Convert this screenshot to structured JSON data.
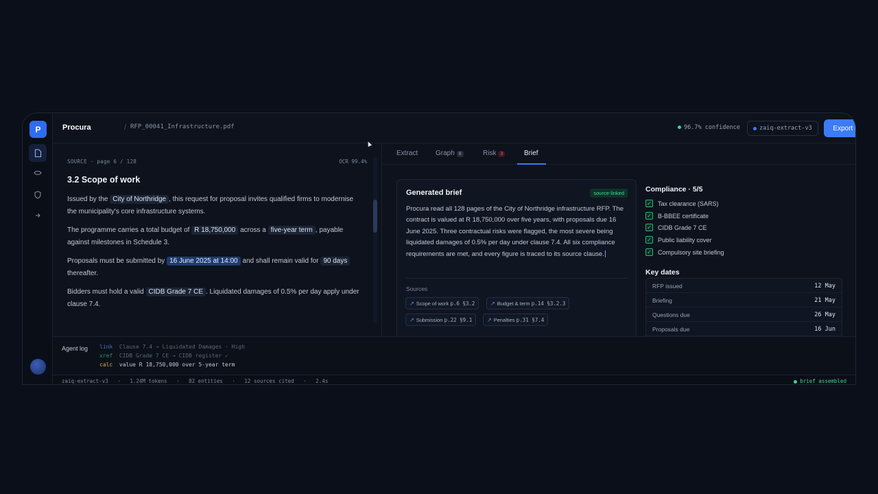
{
  "app": {
    "brand": "Procura",
    "separator": "/",
    "filename": "RFP_00041_Infrastructure.pdf",
    "logo_letter": "P"
  },
  "header": {
    "confidence": "96.7% confidence",
    "model": "zaiq-extract-v3",
    "export_label": "Export brief",
    "accent": "#3b7cf6"
  },
  "rail": {
    "icons": [
      "document-icon",
      "eye-icon",
      "shield-icon",
      "arrow-icon"
    ]
  },
  "source": {
    "meta": "SOURCE · page 6 / 128",
    "ocr": "OCR 99.4%",
    "heading": "3.2 Scope of work",
    "p1": {
      "a": "Issued by the",
      "city": "City of Northridge",
      "b": ", this request for proposal invites qualified firms to modernise the municipality's core infrastructure systems."
    },
    "p2": {
      "a": "The programme carries a total budget of",
      "budget": "R 18,750,000",
      "b": "across a",
      "term": "five-year term",
      "c": ", payable against milestones in Schedule 3."
    },
    "p3": {
      "a": "Proposals must be submitted by",
      "deadline": "16 June 2025 at 14:00",
      "b": "and shall remain valid for",
      "validity": "90 days",
      "c": "thereafter."
    },
    "p4": {
      "a": "Bidders must hold a valid",
      "grade": "CIDB Grade 7 CE",
      "b": ". Liquidated damages of 0.5% per day apply under clause 7.4."
    }
  },
  "tabs": [
    {
      "label": "Extract"
    },
    {
      "label": "Graph",
      "count": "8"
    },
    {
      "label": "Risk",
      "count": "3"
    },
    {
      "label": "Brief"
    }
  ],
  "brief": {
    "title": "Generated brief",
    "tag": "source-linked",
    "text": "Procura read all 128 pages of the City of Northridge infrastructure RFP. The contract is valued at R 18,750,000 over five years, with proposals due 16 June 2025. Three contractual risks were flagged, the most severe being liquidated damages of 0.5% per day under clause 7.4. All six compliance requirements are met, and every figure is traced to its source clause.",
    "sources_label": "Sources",
    "sources": [
      {
        "label": "Scope of work",
        "ref": "p.6 §3.2"
      },
      {
        "label": "Budget & term",
        "ref": "p.14 §3.2.3"
      },
      {
        "label": "Submission",
        "ref": "p.22 §9.1"
      },
      {
        "label": "Penalties",
        "ref": "p.31 §7.4"
      }
    ]
  },
  "compliance": {
    "title": "Compliance · 5/5",
    "items": [
      "Tax clearance (SARS)",
      "B-BBEE certificate",
      "CIDB Grade 7 CE",
      "Public liability cover",
      "Compulsory site briefing"
    ]
  },
  "key_dates": {
    "title": "Key dates",
    "rows": [
      {
        "label": "RFP issued",
        "value": "12 May"
      },
      {
        "label": "Briefing",
        "value": "21 May"
      },
      {
        "label": "Questions due",
        "value": "26 May"
      },
      {
        "label": "Proposals due",
        "value": "16 Jun"
      }
    ]
  },
  "agent": {
    "label": "Agent log",
    "lines": [
      {
        "kind": "link",
        "text": "Clause 7.4 → Liquidated Damages · High",
        "color": "#4a6fbf"
      },
      {
        "kind": "xref",
        "text": "CIDB Grade 7 CE → CIDB register ✓",
        "color": "#3a8f6a"
      },
      {
        "kind": "calc",
        "text": "value R 18,750,000 over 5-year term",
        "color": "#e0b341"
      }
    ]
  },
  "status": {
    "model": "zaiq-extract-v3",
    "tokens": "1.24M tokens",
    "entities": "82 entities",
    "sources": "12 sources cited",
    "time": "2.4s",
    "state": "brief assembled"
  }
}
